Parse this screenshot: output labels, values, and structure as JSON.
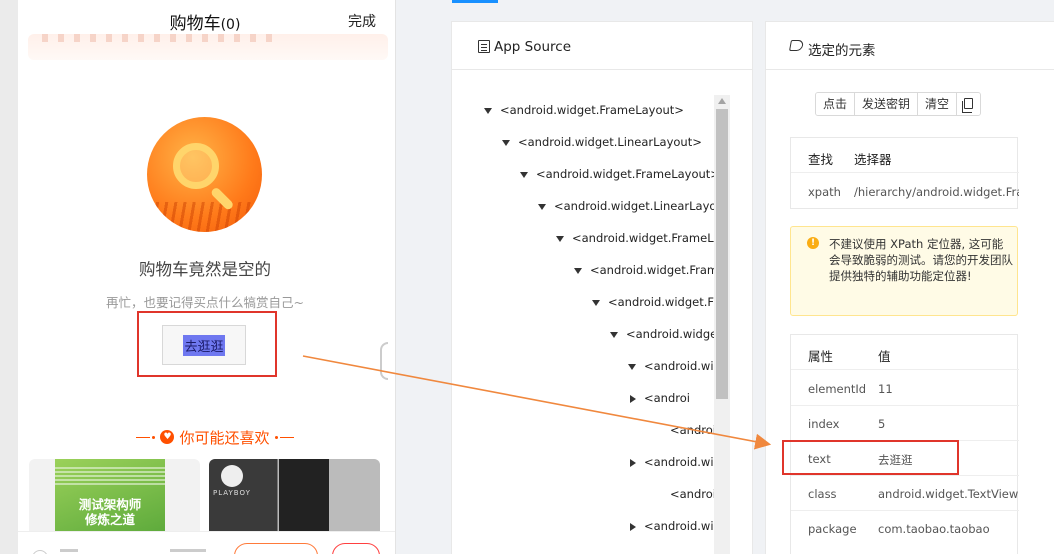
{
  "phone": {
    "title": "购物车",
    "count": "(0)",
    "done": "完成",
    "empty_title": "购物车竟然是空的",
    "empty_sub": "再忙，也要记得买点什么犒赏自己~",
    "go_shop": "去逛逛",
    "like_title": "你可能还喜欢",
    "book_title_1": "测试架构师",
    "book_title_2": "修炼之道",
    "brand": "PLAYBOY"
  },
  "source_panel": {
    "title": "App Source",
    "nodes": [
      {
        "label": "<android.widget.FrameLayout>",
        "arrow": "down"
      },
      {
        "label": "<android.widget.LinearLayout>",
        "arrow": "down"
      },
      {
        "label": "<android.widget.FrameLayout>",
        "arrow": "down"
      },
      {
        "label": "<android.widget.LinearLayou",
        "arrow": "down"
      },
      {
        "label": "<android.widget.FrameLa",
        "arrow": "down"
      },
      {
        "label": "<android.widget.Fram",
        "arrow": "down"
      },
      {
        "label": "<android.widget.Fr",
        "arrow": "down"
      },
      {
        "label": "<android.widge",
        "arrow": "down"
      },
      {
        "label": "<android.wi",
        "arrow": "down"
      },
      {
        "label": "<androi",
        "arrow": "right"
      },
      {
        "label": "<android.wi",
        "arrow": "none"
      },
      {
        "label": "<android.wi",
        "arrow": "right"
      },
      {
        "label": "<android.wi",
        "arrow": "none"
      },
      {
        "label": "<android.wi",
        "arrow": "right"
      }
    ]
  },
  "selected_panel": {
    "title": "选定的元素",
    "buttons": [
      "点击",
      "发送密钥",
      "清空"
    ],
    "find_header": {
      "k": "查找",
      "v": "选择器"
    },
    "find_row": {
      "k": "xpath",
      "v": "/hierarchy/android.widget.FrameLayout"
    },
    "warning": "不建议使用 XPath 定位器, 这可能会导致脆弱的测试。请您的开发团队提供独特的辅助功能定位器!",
    "attr_header": {
      "k": "属性",
      "v": "值"
    },
    "attributes": [
      {
        "k": "elementId",
        "v": "11"
      },
      {
        "k": "index",
        "v": "5"
      },
      {
        "k": "text",
        "v": "去逛逛"
      },
      {
        "k": "class",
        "v": "android.widget.TextView"
      },
      {
        "k": "package",
        "v": "com.taobao.taobao"
      }
    ]
  },
  "colors": {
    "accent": "#1890ff",
    "highlight": "#e0352b",
    "arrow": "#f0883e",
    "taobao": "#ff5000"
  }
}
